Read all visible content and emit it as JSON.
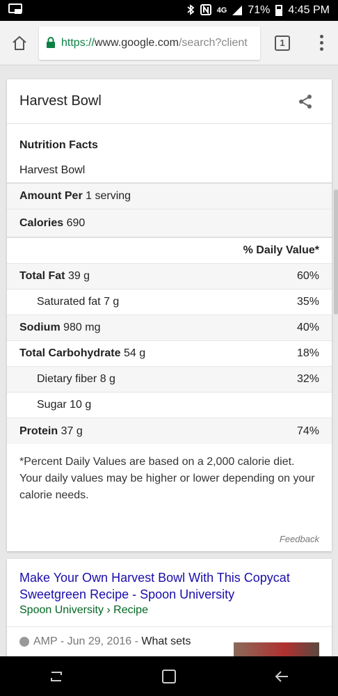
{
  "status_bar": {
    "battery_percent": "71%",
    "time": "4:45 PM",
    "network": "4G",
    "icons": [
      "cast-icon",
      "bluetooth-icon",
      "nfc-icon",
      "lte-icon",
      "signal-icon",
      "battery-icon"
    ]
  },
  "browser": {
    "url_scheme": "https://",
    "url_host": "www.google.com",
    "url_path": "/search?client",
    "tab_count": "1"
  },
  "nutrition_card": {
    "title": "Harvest Bowl",
    "section_title": "Nutrition Facts",
    "food_name": "Harvest Bowl",
    "amount_per": {
      "label": "Amount Per",
      "value": "1 serving"
    },
    "calories": {
      "label": "Calories",
      "value": "690"
    },
    "daily_value_header": "% Daily Value*",
    "nutrients": [
      {
        "label": "Total Fat",
        "amount": "39 g",
        "dv": "60%",
        "bold": true
      },
      {
        "label": "Saturated fat",
        "amount": "7 g",
        "dv": "35%",
        "bold": false
      },
      {
        "label": "Sodium",
        "amount": "980 mg",
        "dv": "40%",
        "bold": true
      },
      {
        "label": "Total Carbohydrate",
        "amount": "54 g",
        "dv": "18%",
        "bold": true
      },
      {
        "label": "Dietary fiber",
        "amount": "8 g",
        "dv": "32%",
        "bold": false
      },
      {
        "label": "Sugar",
        "amount": "10 g",
        "dv": "",
        "bold": false
      },
      {
        "label": "Protein",
        "amount": "37 g",
        "dv": "74%",
        "bold": true
      }
    ],
    "footnote": "*Percent Daily Values are based on a 2,000 calorie diet. Your daily values may be higher or lower depending on your calorie needs.",
    "feedback": "Feedback"
  },
  "result": {
    "title": "Make Your Own Harvest Bowl With This Copycat Sweetgreen Recipe - Spoon University",
    "breadcrumb": "Spoon University › Recipe",
    "amp_label": "AMP",
    "date": " - Jun 29, 2016 - ",
    "snippet": "What sets"
  },
  "colors": {
    "link": "#1a0dab",
    "url_green": "#006621",
    "secure_green": "#0b8043"
  }
}
